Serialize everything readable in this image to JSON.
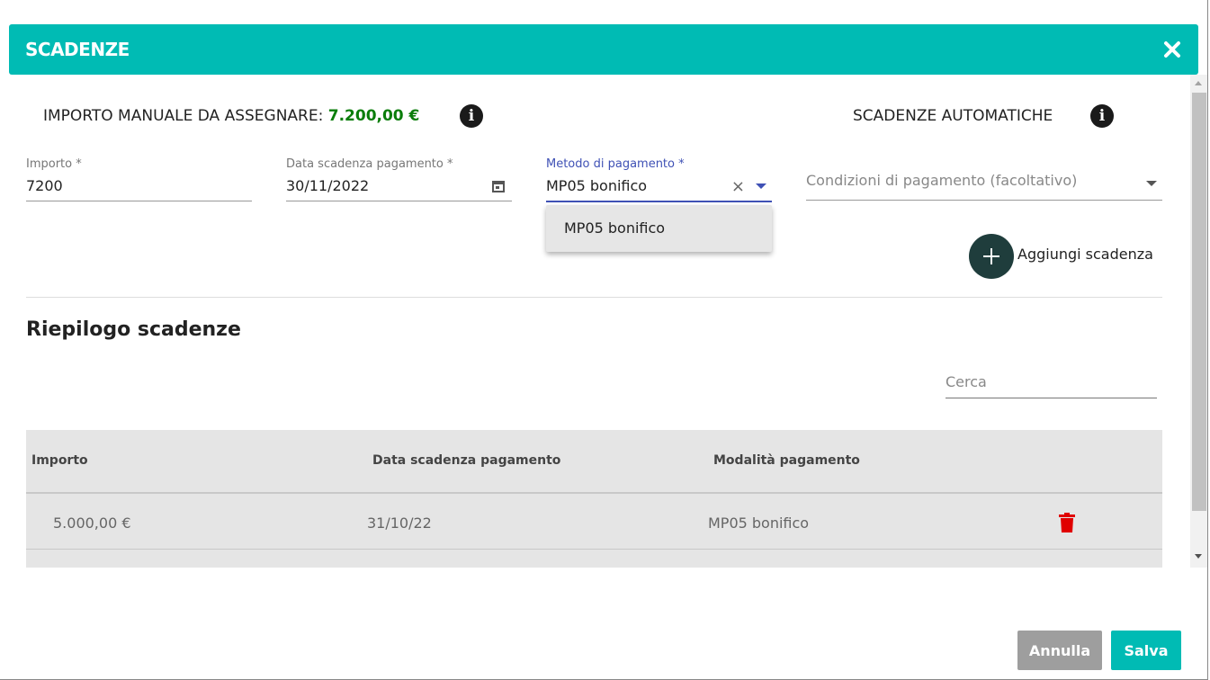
{
  "header": {
    "title": "SCADENZE"
  },
  "manual": {
    "label": "IMPORTO MANUALE DA ASSEGNARE: ",
    "amount": "7.200,00 €"
  },
  "automatic": {
    "label": "SCADENZE AUTOMATICHE"
  },
  "form": {
    "importo": {
      "label": "Importo *",
      "value": "7200"
    },
    "data": {
      "label": "Data scadenza pagamento *",
      "value": "30/11/2022"
    },
    "metodo": {
      "label": "Metodo di pagamento *",
      "value": "MP05 bonifico",
      "clear": "×"
    },
    "condizioni": {
      "placeholder": "Condizioni di pagamento (facoltativo)"
    }
  },
  "dropdown": {
    "options": [
      "MP05 bonifico"
    ]
  },
  "add": {
    "label": "Aggiungi scadenza"
  },
  "summary": {
    "title": "Riepilogo scadenze",
    "search_placeholder": "Cerca"
  },
  "table": {
    "columns": [
      "Importo",
      "Data scadenza pagamento",
      "Modalità pagamento"
    ],
    "rows": [
      {
        "importo": "5.000,00 €",
        "data": "31/10/22",
        "modalita": "MP05 bonifico"
      }
    ]
  },
  "footer": {
    "cancel_label": "Annulla",
    "save_label": "Salva"
  },
  "colors": {
    "accent": "#00bbb4",
    "amount": "#0a7d0a",
    "focus": "#3f51b5",
    "delete": "#e00000",
    "fab": "#1f3d3c"
  },
  "icons": [
    "close-icon",
    "info-icon",
    "calendar-icon",
    "clear-icon",
    "chevron-down-icon",
    "plus-icon",
    "trash-icon"
  ]
}
